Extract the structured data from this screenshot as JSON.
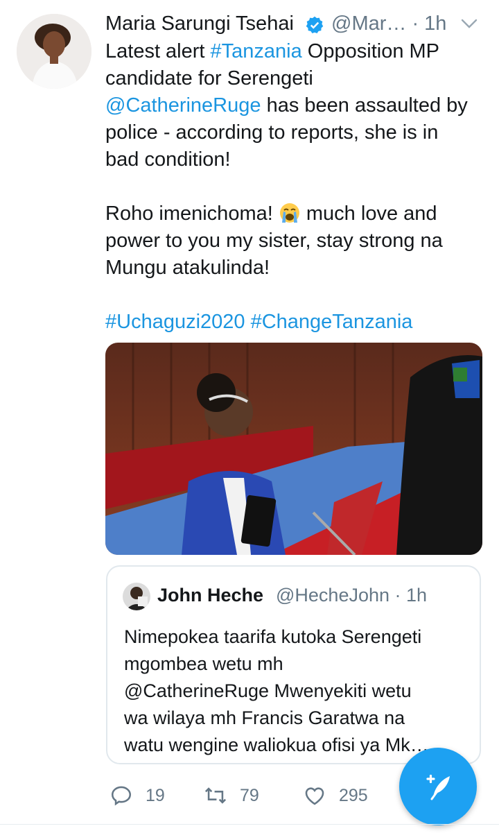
{
  "tweet": {
    "author_name": "Maria Sarungi Tsehai",
    "author_handle": "@Mar…",
    "time": "· 1h",
    "text_line1_pre": "Latest alert ",
    "hashtag_tanzania": "#Tanzania",
    "text_line1_post": " Opposition MP",
    "text_line2": "candidate for Serengeti",
    "mention": "@CatherineRuge",
    "text_line3_post": " has been assaulted by",
    "text_line4": "police - according to reports, she is in",
    "text_line5": "bad condition!",
    "text_para2_pre": "Roho imenichoma! ",
    "text_para2_post": " much love and",
    "text_para2_line2": "power to you my sister, stay strong na",
    "text_para2_line3": "Mungu atakulinda!",
    "hashtags": "#Uchaguzi2020 #ChangeTanzania",
    "emoji": "loudly-crying-face"
  },
  "quoted_tweet": {
    "author_name": "John Heche",
    "author_handle": "@HecheJohn · 1h",
    "text_line1": "Nimepokea taarifa kutoka Serengeti",
    "text_line2": "mgombea wetu mh",
    "text_line3": "@CatherineRuge Mwenyekiti wetu",
    "text_line4": "wa wilaya mh Francis Garatwa na",
    "text_line5": "watu wengine waliokua ofisi ya Mk…"
  },
  "actions": {
    "replies": "19",
    "retweets": "79",
    "likes": "295"
  },
  "icons": {
    "verified": "verified-badge-icon",
    "caret": "chevron-down-icon",
    "reply": "reply-icon",
    "retweet": "retweet-icon",
    "like": "heart-icon",
    "compose": "compose-tweet-icon"
  },
  "colors": {
    "link": "#1b95e0",
    "secondary_text": "#657786",
    "fab": "#1da1f2"
  }
}
